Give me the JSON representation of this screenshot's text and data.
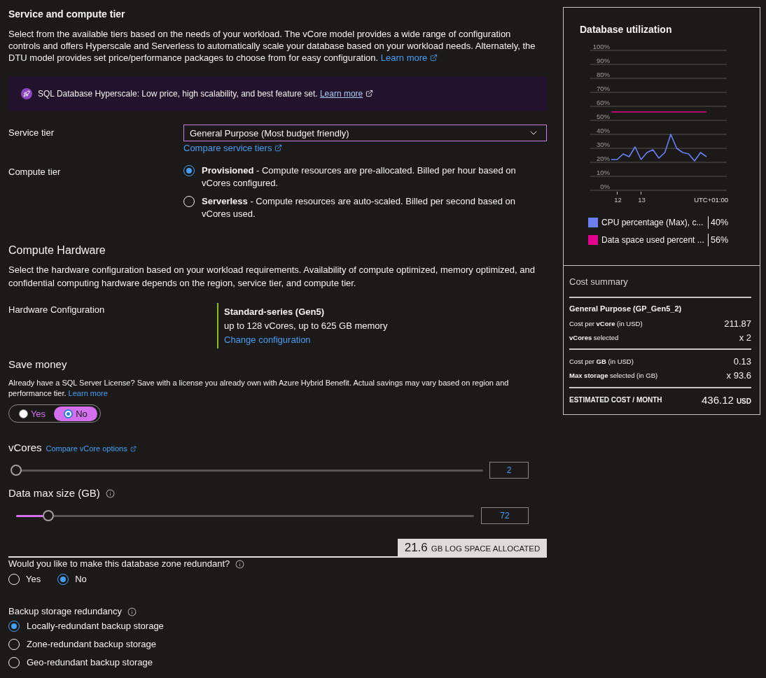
{
  "service_section": {
    "title": "Service and compute tier",
    "description": "Select from the available tiers based on the needs of your workload. The vCore model provides a wide range of configuration controls and offers Hyperscale and Serverless to automatically scale your database based on your workload needs. Alternately, the DTU model provides set price/performance packages to choose from for easy configuration.",
    "learn_more": "Learn more"
  },
  "hyperscale_banner": {
    "text": "SQL Database Hyperscale: Low price, high scalability, and best feature set.",
    "link": "Learn more"
  },
  "service_tier": {
    "label": "Service tier",
    "value": "General Purpose (Most budget friendly)",
    "link": "Compare service tiers"
  },
  "compute_tier": {
    "label": "Compute tier",
    "options": [
      {
        "text": "**Provisioned** - Compute resources are pre-allocated. Billed per hour based on vCores configured.",
        "selected": true
      },
      {
        "text": "**Serverless** - Compute resources are auto-scaled. Billed per second based on vCores used.",
        "selected": false
      }
    ]
  },
  "compute_hardware": {
    "title": "Compute Hardware",
    "description": "Select the hardware configuration based on your workload requirements. Availability of compute optimized, memory optimized, and confidential computing hardware depends on the region, service tier, and compute tier.",
    "config_label": "Hardware Configuration",
    "config_name": "Standard-series (Gen5)",
    "config_details": "up to 128 vCores, up to 625 GB memory",
    "change_link": "Change configuration"
  },
  "save_money": {
    "title": "Save money",
    "description": "Already have a SQL Server License? Save with a license you already own with Azure Hybrid Benefit. Actual savings may vary based on region and performance tier.",
    "learn_more": "Learn more",
    "options": [
      {
        "label": "Yes",
        "selected": false
      },
      {
        "label": "No",
        "selected": true
      }
    ]
  },
  "vcores": {
    "label": "vCores",
    "link": "Compare vCore options",
    "level": 0,
    "value": "2"
  },
  "data_max_size": {
    "label": "Data max size (GB)",
    "level": 0.07,
    "value": "72"
  },
  "log_space": {
    "amount": "21.6",
    "unit": "GB LOG SPACE ALLOCATED"
  },
  "zone_redundancy": {
    "question": "Would you like to make this database zone redundant?",
    "options": [
      {
        "label": "Yes",
        "selected": false
      },
      {
        "label": "No",
        "selected": true
      }
    ]
  },
  "backup_redundancy": {
    "label": "Backup storage redundancy",
    "options": [
      {
        "label": "Locally-redundant backup storage",
        "selected": true
      },
      {
        "label": "Zone-redundant backup storage",
        "selected": false
      },
      {
        "label": "Geo-redundant backup storage",
        "selected": false
      }
    ]
  },
  "utilization": {
    "chart_data": {
      "type": "line",
      "title": "Database utilization",
      "xlabel": "UTC+01:00",
      "categories": [
        null,
        "12",
        null,
        null,
        null,
        "13",
        null,
        null,
        null,
        null,
        null,
        null,
        null,
        null,
        null,
        null,
        null
      ],
      "ylim": [
        0,
        100
      ],
      "yticks": [
        {
          "value": 0,
          "label": "0%"
        },
        {
          "value": 10,
          "label": "10%"
        },
        {
          "value": 20,
          "label": "20%"
        },
        {
          "value": 30,
          "label": "30%"
        },
        {
          "value": 40,
          "label": "40%"
        },
        {
          "value": 50,
          "label": "50%"
        },
        {
          "value": 60,
          "label": "60%"
        },
        {
          "value": 70,
          "label": "70%"
        },
        {
          "value": 80,
          "label": "80%"
        },
        {
          "value": 90,
          "label": "90%"
        },
        {
          "value": 100,
          "label": "100%"
        }
      ],
      "grid": true,
      "legend": true,
      "series": [
        {
          "name": "CPU percentage (Max), c...",
          "color": "#6b7ff0",
          "values": [
            22,
            22,
            26,
            24,
            31,
            22,
            27,
            29,
            23,
            27,
            40,
            30,
            27,
            26,
            21,
            27,
            24
          ]
        },
        {
          "name": "Data space used percent ...",
          "color": "#e3008c",
          "values": [
            56,
            56,
            56,
            56,
            56,
            56,
            56,
            56,
            56,
            56,
            56,
            56,
            56,
            56,
            56,
            56,
            56
          ]
        }
      ]
    },
    "legend_readings": [
      "40%",
      "56%"
    ]
  },
  "cost_summary": {
    "title": "Cost summary",
    "tier": "General Purpose (GP_Gen5_2)",
    "compute_rows": [
      {
        "label": "Cost per **vCore** (in USD)",
        "value": "211.87"
      },
      {
        "label": "**vCores** selected",
        "value": "x 2"
      }
    ],
    "storage_rows": [
      {
        "label": "Cost per **GB** (in USD)",
        "value": "0.13"
      },
      {
        "label": "**Max storage** selected (in GB)",
        "value": "x 93.6"
      }
    ],
    "total": {
      "label": "ESTIMATED COST / MONTH",
      "amount": "436.12",
      "currency": "USD"
    }
  }
}
